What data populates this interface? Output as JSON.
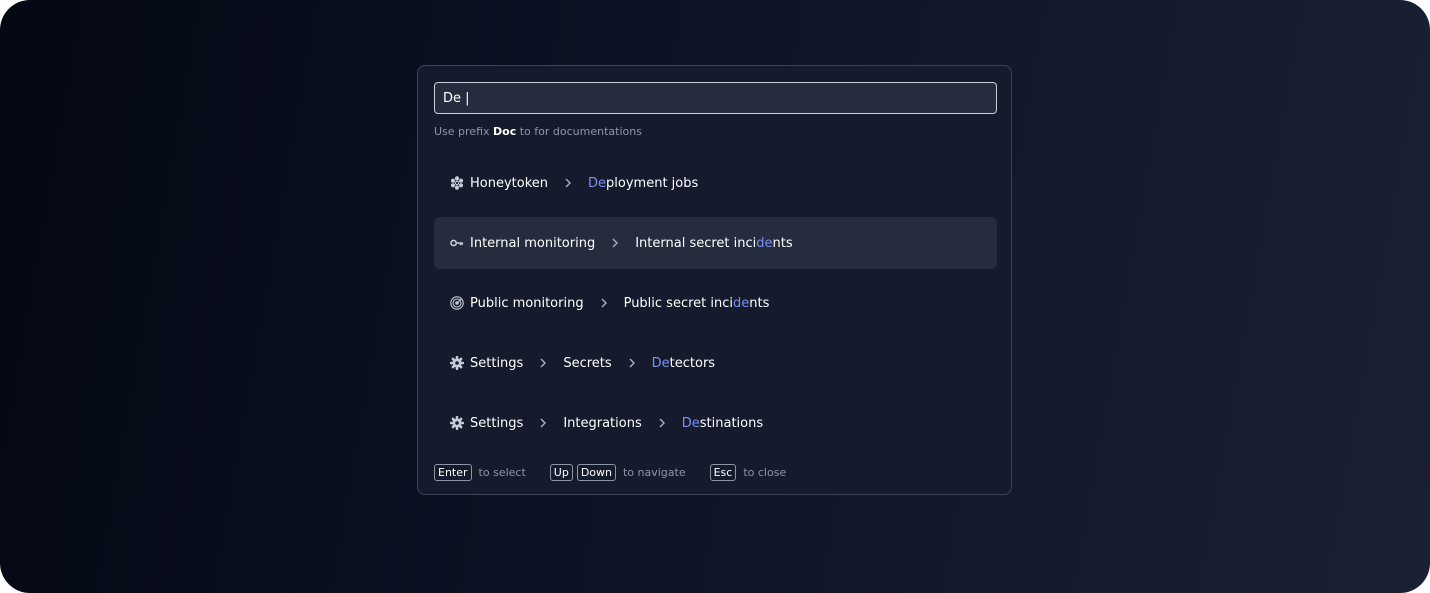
{
  "search": {
    "value": "De |",
    "placeholder": ""
  },
  "hint": {
    "pre": "Use prefix ",
    "keyword": "Doc",
    "post": " to for documentations"
  },
  "results": [
    {
      "icon": "honeycomb-icon",
      "parts": [
        "Honeytoken"
      ],
      "match_pre": "",
      "match": "De",
      "match_post": "ployment jobs",
      "active": false
    },
    {
      "icon": "key-icon",
      "parts": [
        "Internal monitoring"
      ],
      "match_pre": "Internal secret inci",
      "match": "de",
      "match_post": "nts",
      "active": true
    },
    {
      "icon": "radar-icon",
      "parts": [
        "Public monitoring"
      ],
      "match_pre": "Public secret inci",
      "match": "de",
      "match_post": "nts",
      "active": false
    },
    {
      "icon": "gear-icon",
      "parts": [
        "Settings",
        "Secrets"
      ],
      "match_pre": "",
      "match": "De",
      "match_post": "tectors",
      "active": false
    },
    {
      "icon": "gear-icon",
      "parts": [
        "Settings",
        "Integrations"
      ],
      "match_pre": "",
      "match": "De",
      "match_post": "stinations",
      "active": false
    }
  ],
  "footer": {
    "enter_key": "Enter",
    "enter_text": "to select",
    "up_key": "Up",
    "down_key": "Down",
    "navigate_text": "to navigate",
    "esc_key": "Esc",
    "esc_text": "to close"
  },
  "colors": {
    "highlight": "#7b8ff5",
    "active_row": "#252c3e",
    "panel": "#151b2c"
  }
}
